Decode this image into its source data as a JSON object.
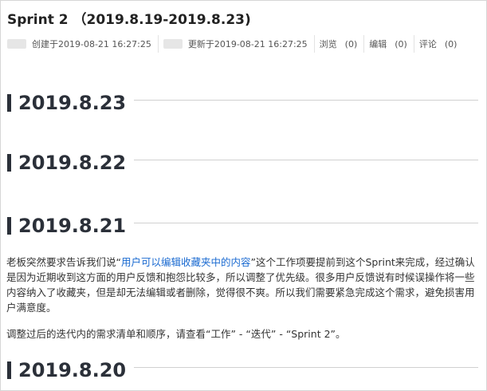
{
  "header": {
    "title": "Sprint 2 （2019.8.19-2019.8.23)",
    "created": "创建于2019-08-21 16:27:25",
    "updated": "更新于2019-08-21 16:27:25",
    "stats": [
      {
        "label": "浏览",
        "count": "(0)"
      },
      {
        "label": "编辑",
        "count": "(0)"
      },
      {
        "label": "评论",
        "count": "(0)"
      }
    ]
  },
  "sections": [
    {
      "heading": "2019.8.23"
    },
    {
      "heading": "2019.8.22"
    },
    {
      "heading": "2019.8.21"
    },
    {
      "heading": "2019.8.20"
    }
  ],
  "content": {
    "para1_before": "老板突然要求告诉我们说“",
    "para1_link": "用户可以编辑收藏夹中的内容",
    "para1_after": "”这个工作项要提前到这个Sprint来完成，经过确认是因为近期收到这方面的用户反馈和抱怨比较多，所以调整了优先级。很多用户反馈说有时候误操作将一些内容纳入了收藏夹，但是却无法编辑或者删除，觉得很不爽。所以我们需要紧急完成这个需求，避免损害用户满意度。",
    "para2": "调整过后的迭代内的需求清单和顺序，请查看“工作” - “迭代” - “Sprint 2”。"
  },
  "colors": {
    "link": "#1a6ad1",
    "heading_bar": "#2b3039"
  }
}
